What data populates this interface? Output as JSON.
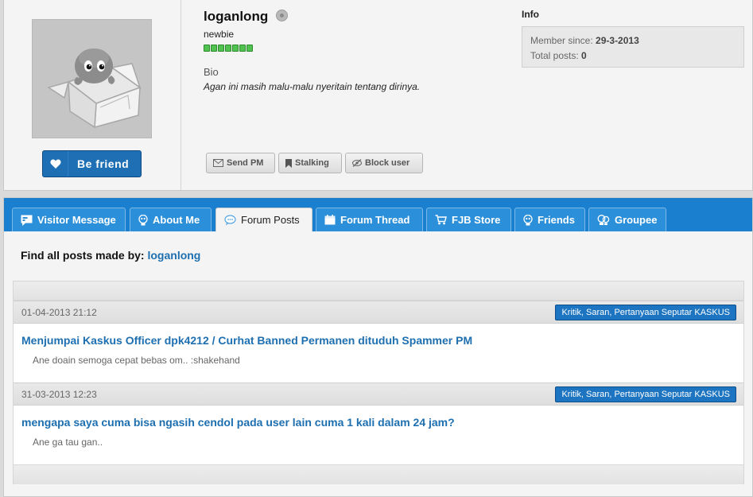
{
  "profile": {
    "username": "loganlong",
    "rank": "newbie",
    "reputation_blocks": 7,
    "bio_label": "Bio",
    "bio_text": "Agan ini masih malu-malu nyeritain tentang dirinya.",
    "befriend_label": "Be friend",
    "actions": {
      "send_pm": "Send PM",
      "stalking": "Stalking",
      "block_user": "Block user"
    }
  },
  "info": {
    "title": "Info",
    "member_since_label": "Member since:",
    "member_since_value": "29-3-2013",
    "total_posts_label": "Total posts:",
    "total_posts_value": "0"
  },
  "tabs": [
    {
      "label": "Visitor Message",
      "icon": "message-icon"
    },
    {
      "label": "About Me",
      "icon": "bulb-icon"
    },
    {
      "label": "Forum Posts",
      "icon": "chat-bubble-icon"
    },
    {
      "label": "Forum Thread",
      "icon": "calendar-icon"
    },
    {
      "label": "FJB Store",
      "icon": "cart-icon"
    },
    {
      "label": "Friends",
      "icon": "bulb-icon"
    },
    {
      "label": "Groupee",
      "icon": "group-icon"
    }
  ],
  "active_tab": "Forum Posts",
  "find_posts": {
    "label": "Find all posts made by:",
    "user": "loganlong"
  },
  "posts": [
    {
      "date": "01-04-2013 21:12",
      "forum": "Kritik, Saran, Pertanyaan Seputar KASKUS",
      "title": "Menjumpai Kaskus Officer dpk4212 / Curhat Banned Permanen dituduh Spammer PM",
      "snippet": "Ane doain semoga cepat bebas om.. :shakehand"
    },
    {
      "date": "31-03-2013 12:23",
      "forum": "Kritik, Saran, Pertanyaan Seputar KASKUS",
      "title": "mengapa saya cuma bisa ngasih cendol pada user lain cuma 1 kali dalam 24 jam?",
      "snippet": "Ane ga tau gan.."
    }
  ],
  "colors": {
    "accent": "#1a7fcf",
    "link": "#1d6fb0",
    "badge": "#1d75c2",
    "reputation": "#4fc24f"
  }
}
